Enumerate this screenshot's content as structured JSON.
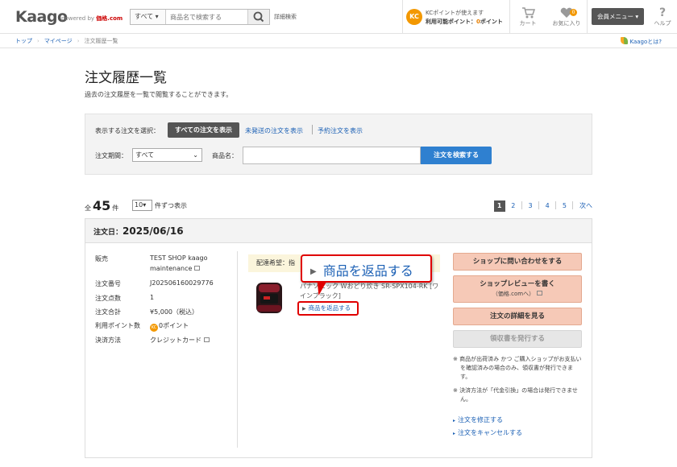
{
  "header": {
    "logo": "Kaago",
    "powered_by": "powered by",
    "powered_brand": "価格.com",
    "search_category": "すべて",
    "search_placeholder": "商品名で検索する",
    "detail_search": "詳細検索",
    "kc_badge": "KC",
    "kc_line1": "KCポイントが使えます",
    "kc_line2_prefix": "利用可能ポイント：",
    "kc_points": "0",
    "kc_line2_suffix": "ポイント",
    "cart_label": "カート",
    "favorites_label": "お気に入り",
    "favorites_count": "0",
    "member_menu": "会員メニュー",
    "help_label": "ヘルプ"
  },
  "breadcrumb": {
    "items": [
      "トップ",
      "マイページ",
      "注文履歴一覧"
    ],
    "about": "Kaagoとは?"
  },
  "page": {
    "title": "注文履歴一覧",
    "description": "過去の注文履歴を一覧で閲覧することができます。"
  },
  "filter": {
    "select_label": "表示する注文を選択：",
    "tab_all": "すべての注文を表示",
    "tab_unshipped": "未発送の注文を表示",
    "tab_preorder": "予約注文を表示",
    "period_label": "注文期間：",
    "period_value": "すべて",
    "name_label": "商品名：",
    "search_button": "注文を検索する"
  },
  "listing": {
    "total_prefix": "全",
    "total": "45",
    "total_suffix": "件",
    "per_page": "10",
    "per_page_label": "件ずつ表示",
    "pages": [
      "1",
      "2",
      "3",
      "4",
      "5"
    ],
    "current_page": "1",
    "next": "次へ"
  },
  "order": {
    "date_label": "注文日：",
    "date": "2025/06/16",
    "fields": {
      "seller_label": "販売",
      "seller_value_1": "TEST SHOP kaago",
      "seller_value_2": "maintenance",
      "number_label": "注文番号",
      "number_value": "J202506160029776",
      "count_label": "注文点数",
      "count_value": "1",
      "total_label": "注文合計",
      "total_value": "¥5,000（税込）",
      "points_label": "利用ポイント数",
      "points_value": "0ポイント",
      "payment_label": "決済方法",
      "payment_value": "クレジットカード"
    },
    "delivery": "配達希望：指",
    "product_name": "パナソニック Wおどり炊き SR-SPX104-RK [ワインブラック]",
    "return_link": "商品を返品する",
    "callout_text": "商品を返品する",
    "buttons": {
      "contact_shop": "ショップに問い合わせをする",
      "review_shop": "ショップレビューを書く",
      "review_shop_sub": "（価格.comへ）",
      "order_detail": "注文の詳細を見る",
      "issue_receipt": "領収書を発行する"
    },
    "notes": {
      "note1": "※ 商品が出荷済み かつ ご購入ショップがお支払いを確認済みの場合のみ、領収書が発行できます。",
      "note2": "※ 決済方法が「代金引換」の場合は発行できません。"
    },
    "links": {
      "modify": "注文を修正する",
      "cancel": "注文をキャンセルする"
    }
  },
  "colors": {
    "accent_orange": "#f39800",
    "link_blue": "#1a5fb4",
    "callout_red": "#e00000",
    "action_button": "#f6c9b7",
    "search_button": "#2f80d0"
  }
}
